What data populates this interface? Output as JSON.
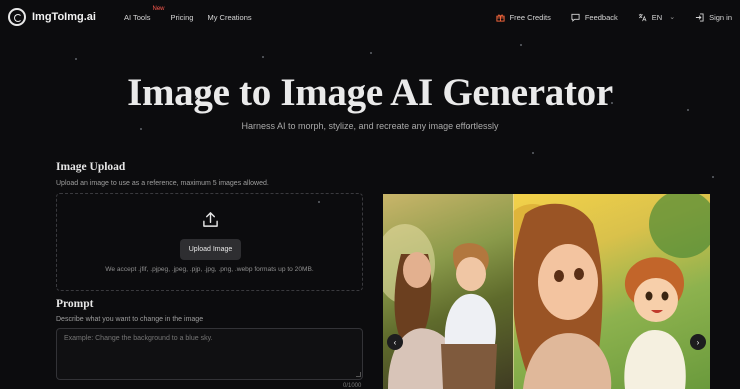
{
  "brand": {
    "name": "ImgToImg.ai"
  },
  "nav": {
    "links": [
      {
        "label": "AI Tools",
        "badge": "New"
      },
      {
        "label": "Pricing"
      },
      {
        "label": "My Creations"
      }
    ],
    "free_credits": "Free Credits",
    "feedback": "Feedback",
    "language": "EN",
    "sign_in": "Sign in"
  },
  "hero": {
    "title": "Image to Image AI Generator",
    "subtitle": "Harness AI to morph, stylize, and recreate any image effortlessly"
  },
  "upload": {
    "title": "Image Upload",
    "description": "Upload an image to use as a reference, maximum 5 images allowed.",
    "button": "Upload Image",
    "formats_note": "We accept .jfif, .pjpeg, .jpeg, .pjp, .jpg, .png, .webp formats up to 20MB."
  },
  "prompt": {
    "title": "Prompt",
    "description": "Describe what you want to change in the image",
    "placeholder": "Example: Change the background to a blue sky.",
    "char_count": "0/1000"
  },
  "carousel": {
    "prev_icon": "chevron-left-icon",
    "next_icon": "chevron-right-icon"
  },
  "colors": {
    "background": "#0c0c0e",
    "badge_new": "#ff5a4f",
    "gift_icon": "#ff6a3d"
  }
}
